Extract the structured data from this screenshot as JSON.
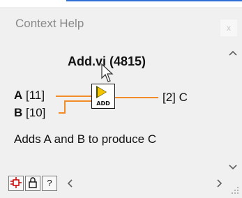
{
  "window": {
    "title": "Context Help",
    "close_glyph": "x"
  },
  "vi": {
    "name": "Add.vi (4815)",
    "icon_label": "ADD",
    "icon_color": "#f2c500",
    "wire_color": "#f28c28",
    "inputs": [
      {
        "name": "A",
        "index": "[11]"
      },
      {
        "name": "B",
        "index": "[10]"
      }
    ],
    "output": {
      "index": "[2]",
      "name": "C"
    },
    "description": "Adds A and B to produce C"
  },
  "toolbar": {
    "buttons": [
      {
        "name": "show-optional-terminals-icon"
      },
      {
        "name": "lock-icon"
      },
      {
        "name": "detailed-help-icon",
        "glyph": "?"
      }
    ]
  },
  "scroll": {
    "up": "^",
    "down": "v",
    "left": "<",
    "right": ">"
  }
}
